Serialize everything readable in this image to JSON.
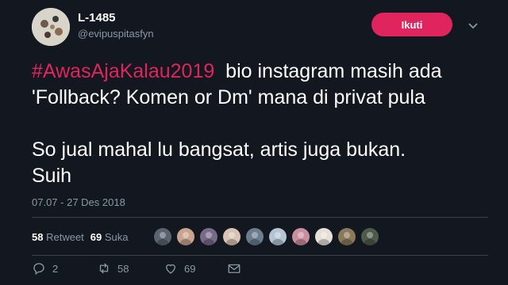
{
  "user": {
    "name": "L-1485",
    "handle": "@evipuspitasfyn"
  },
  "follow_label": "Ikuti",
  "tweet": {
    "hashtag": "#AwasAjaKalau2019",
    "line1_rest": "  bio instagram masih ada",
    "line2": "'Follback? Komen or Dm' mana di privat pula",
    "line3": "So jual mahal lu bangsat, artis juga bukan.",
    "line4": "Suih"
  },
  "timestamp": "07.07 - 27 Des 2018",
  "stats": {
    "retweets_count": "58",
    "retweets_label": "Retweet",
    "likes_count": "69",
    "likes_label": "Suka"
  },
  "likers": [
    "#5a6470",
    "#c9a58f",
    "#7a6a8a",
    "#d8c3b5",
    "#6b7d8f",
    "#b5c4d3",
    "#c98f9f",
    "#e6e0d8",
    "#8a7a5a",
    "#4f5a4a"
  ],
  "actions": {
    "reply_count": "2",
    "retweet_count": "58",
    "like_count": "69"
  },
  "colors": {
    "background": "#13171f",
    "accent": "#e0245e",
    "secondary_text": "#8899a6"
  }
}
